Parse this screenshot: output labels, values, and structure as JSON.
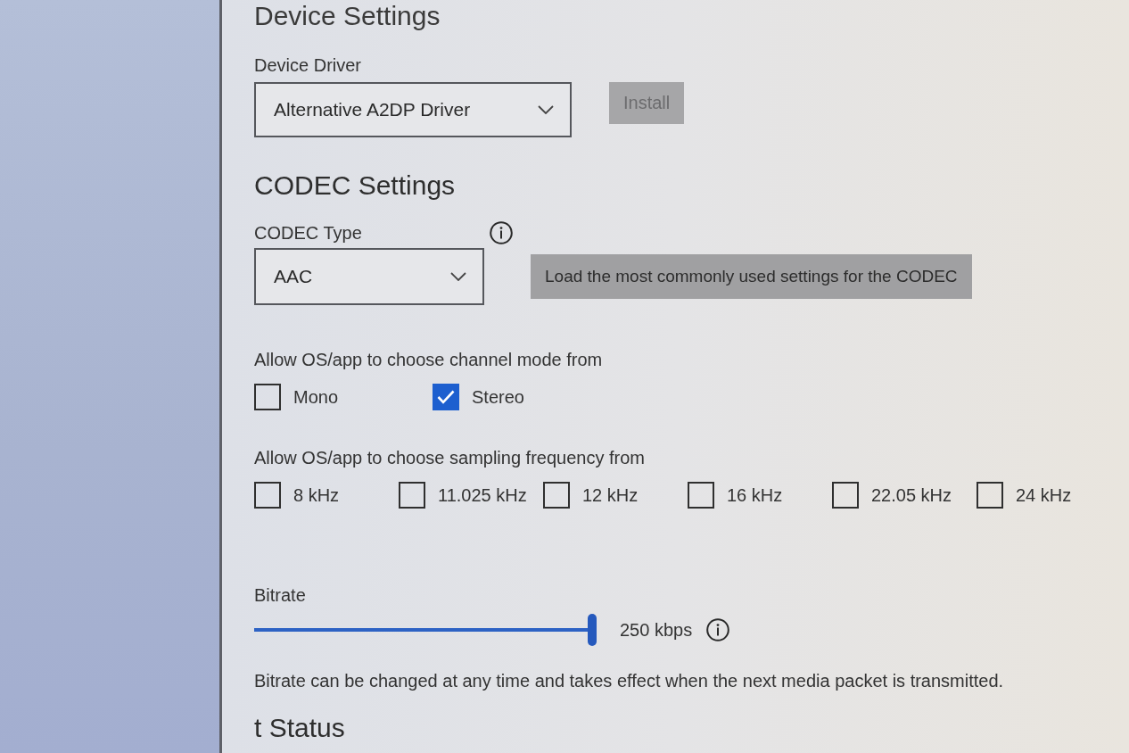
{
  "page": {
    "title": "Device Settings"
  },
  "device_driver": {
    "label": "Device Driver",
    "value": "Alternative A2DP Driver",
    "install_button": {
      "label": "Install",
      "disabled": true
    }
  },
  "codec_settings": {
    "heading": "CODEC Settings",
    "codec_type": {
      "label": "CODEC Type",
      "value": "AAC"
    },
    "load_defaults_button": {
      "label": "Load the most commonly used settings for the CODEC",
      "disabled": false
    }
  },
  "channel_mode": {
    "label": "Allow OS/app to choose channel mode from",
    "options": [
      {
        "label": "Mono",
        "checked": false
      },
      {
        "label": "Stereo",
        "checked": true
      }
    ]
  },
  "sampling_frequency": {
    "label": "Allow OS/app to choose sampling frequency from",
    "options": [
      {
        "label": "8 kHz",
        "checked": false
      },
      {
        "label": "11.025 kHz",
        "checked": false
      },
      {
        "label": "12 kHz",
        "checked": false
      },
      {
        "label": "16 kHz",
        "checked": false
      },
      {
        "label": "22.05 kHz",
        "checked": false
      },
      {
        "label": "24 kHz",
        "checked": false
      }
    ]
  },
  "bitrate": {
    "label": "Bitrate",
    "level": 1,
    "reading": "250 kbps",
    "note": "Bitrate can be changed at any time and takes effect when the next media packet is transmitted."
  },
  "next_section": {
    "heading": "t Status"
  }
}
